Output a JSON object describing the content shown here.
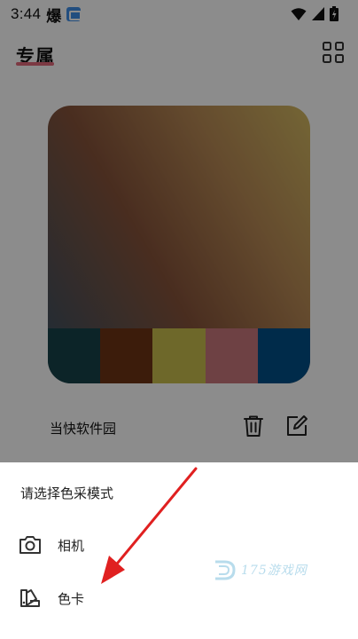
{
  "status_bar": {
    "time": "3:44",
    "extra": "爆",
    "app_icon": "gallery-app-icon",
    "icons": [
      "wifi-icon",
      "cell-signal-icon",
      "battery-icon"
    ]
  },
  "header": {
    "title": "专属",
    "accent_color": "#e2687b",
    "grid_icon": "grid-icon"
  },
  "palette_card": {
    "swatches": [
      "#17424a",
      "#6e3414",
      "#c9bd4e",
      "#c8777c",
      "#004f88"
    ]
  },
  "card_row": {
    "name": "当快软件园",
    "delete_icon": "trash-icon",
    "edit_icon": "edit-icon"
  },
  "sheet": {
    "title": "请选择色采模式",
    "options": [
      {
        "label": "相机",
        "icon": "camera-icon"
      },
      {
        "label": "色卡",
        "icon": "color-card-icon"
      }
    ]
  },
  "watermark": {
    "text": "175游戏网",
    "color": "#7fc0de"
  },
  "annotation": {
    "color": "#e02020"
  }
}
